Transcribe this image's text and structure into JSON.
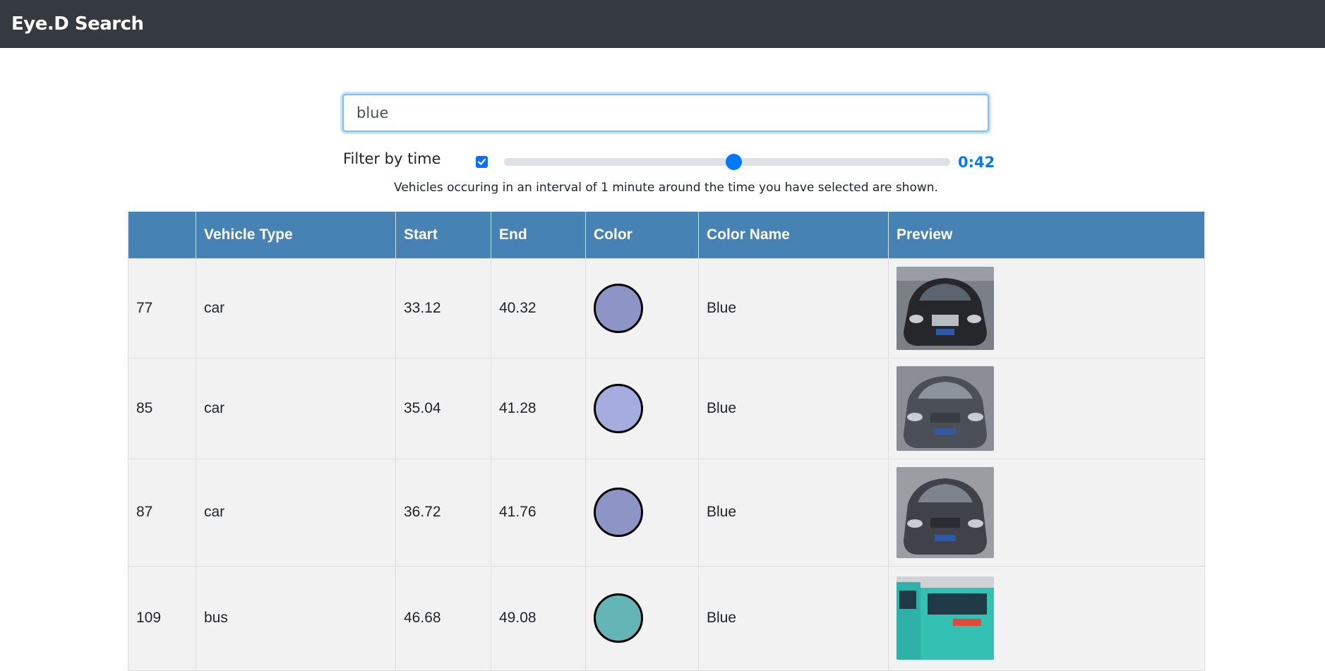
{
  "app": {
    "brand": "Eye.D Search"
  },
  "search": {
    "value": "blue",
    "placeholder": ""
  },
  "filter": {
    "label": "Filter by time",
    "enabled": true,
    "slider_fraction": 0.515,
    "value_label": "0:42",
    "hint": "Vehicles occuring in an interval of 1 minute around the time you have selected are shown."
  },
  "table": {
    "headers": [
      "",
      "Vehicle Type",
      "Start",
      "End",
      "Color",
      "Color Name",
      "Preview"
    ],
    "rows": [
      {
        "id": "77",
        "type": "car",
        "start": "33.12",
        "end": "40.32",
        "color": "#8d95c6",
        "color_name": "Blue",
        "preview": "car-dark-icon"
      },
      {
        "id": "85",
        "type": "car",
        "start": "35.04",
        "end": "41.28",
        "color": "#a4ace0",
        "color_name": "Blue",
        "preview": "car-grey-icon"
      },
      {
        "id": "87",
        "type": "car",
        "start": "36.72",
        "end": "41.76",
        "color": "#8d95c6",
        "color_name": "Blue",
        "preview": "car-grey-icon"
      },
      {
        "id": "109",
        "type": "bus",
        "start": "46.68",
        "end": "49.08",
        "color": "#64b5b5",
        "color_name": "Blue",
        "preview": "bus-teal-icon"
      }
    ]
  },
  "colors": {
    "navbar": "#343a40",
    "header": "#4682b4",
    "accent": "#007bff",
    "row_bg": "#f2f2f2"
  }
}
